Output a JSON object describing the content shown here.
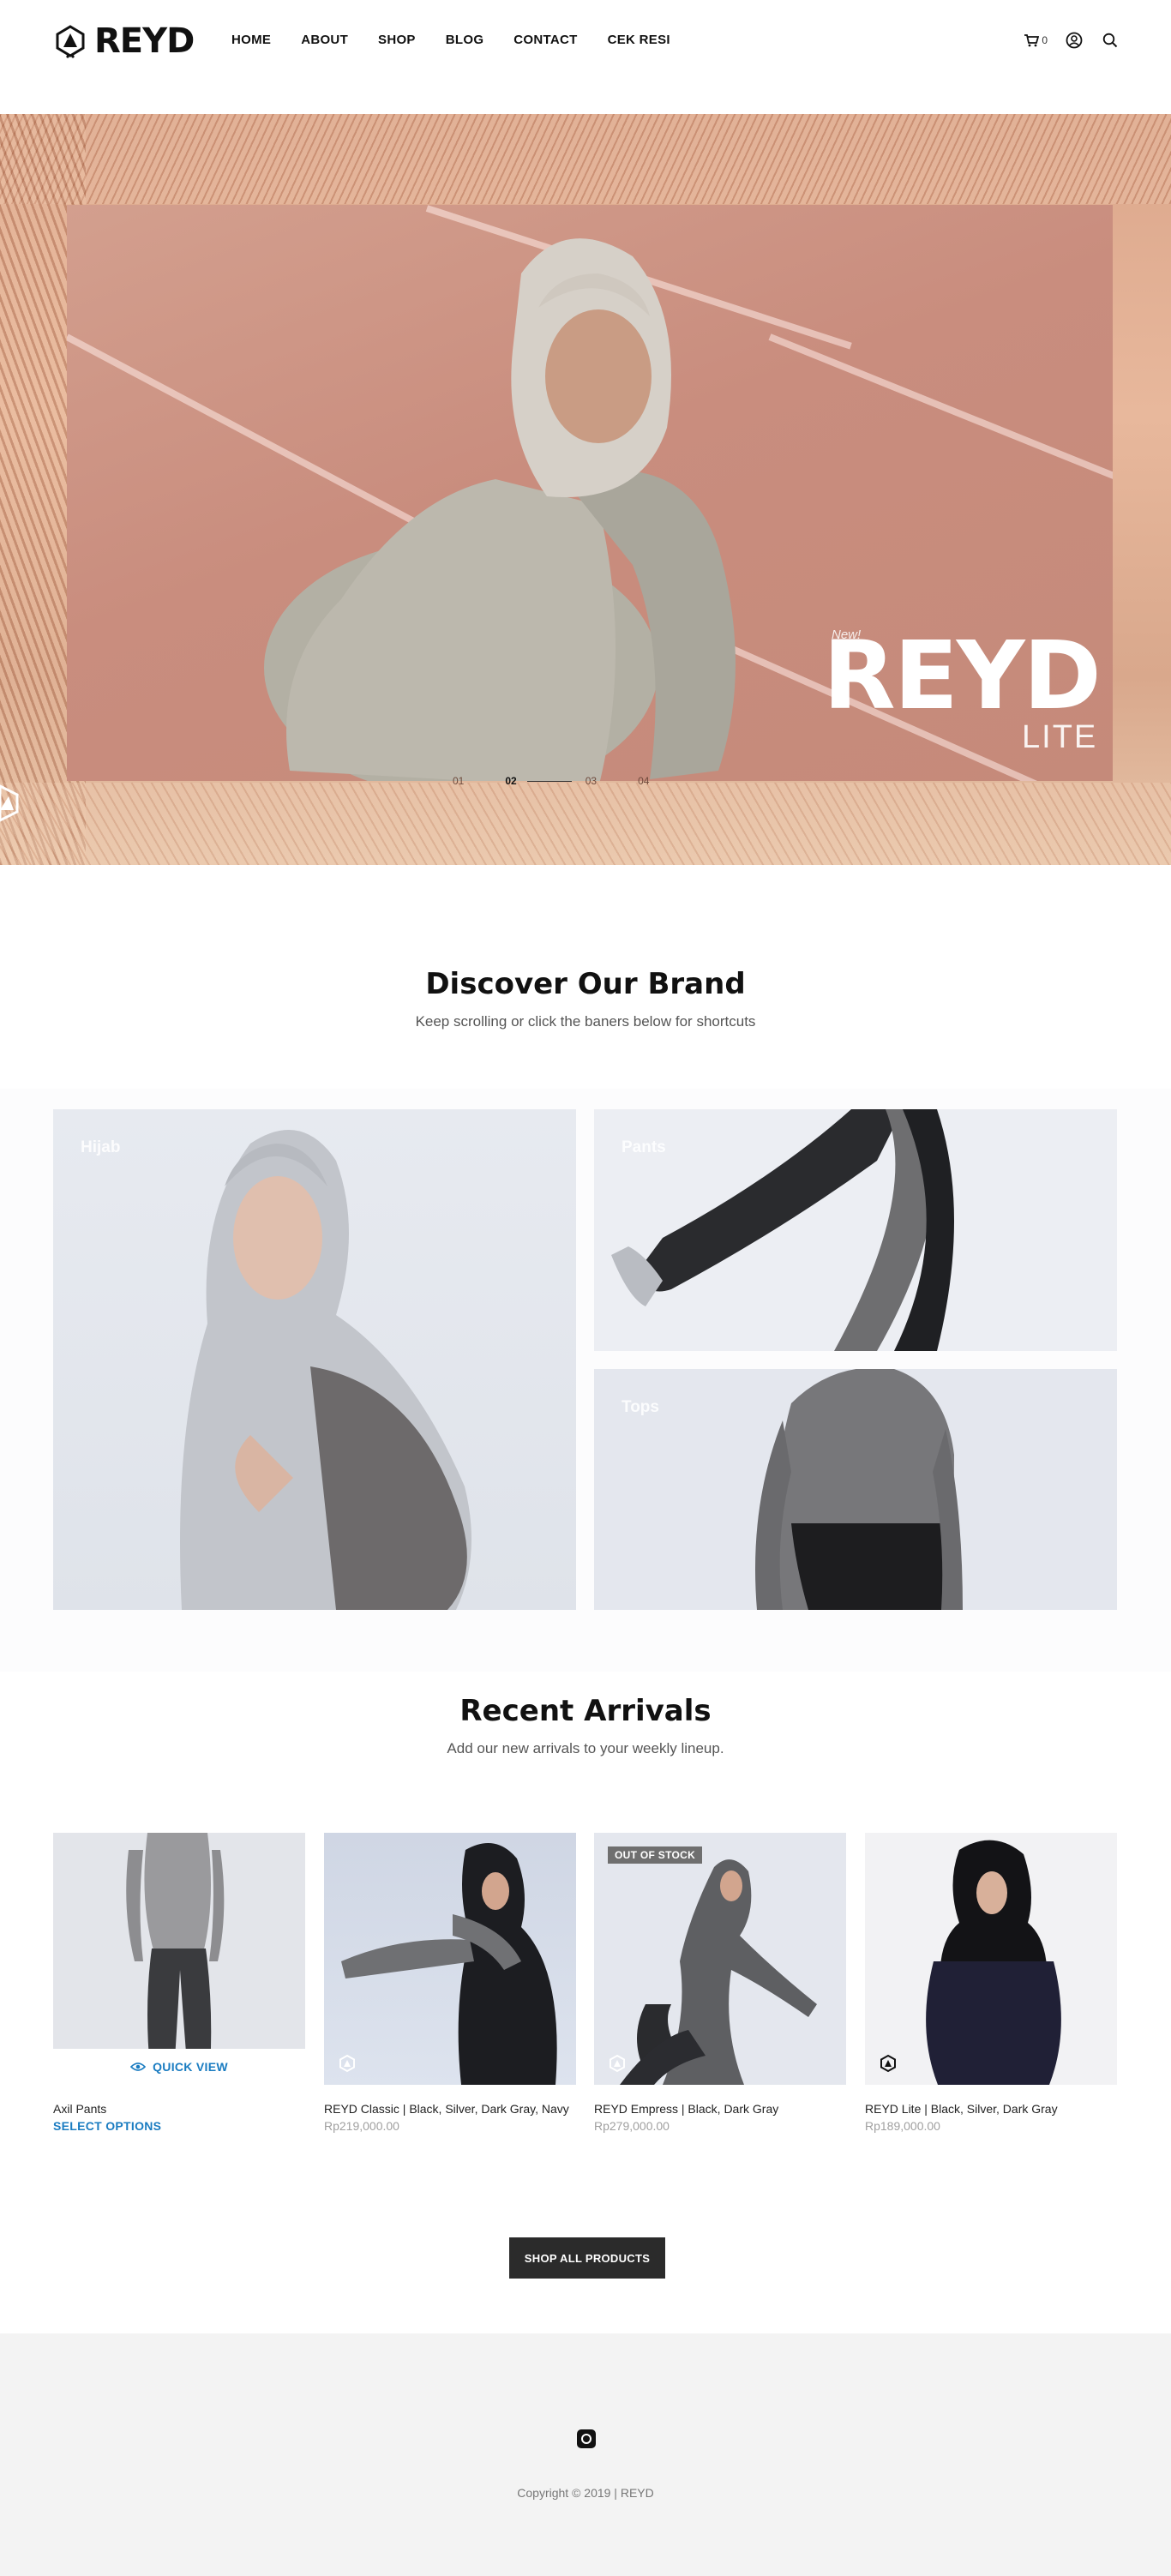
{
  "header": {
    "logo_text": "REYD",
    "nav": [
      "HOME",
      "ABOUT",
      "SHOP",
      "BLOG",
      "CONTACT",
      "CEK RESI"
    ],
    "cart_count": "0",
    "icons": [
      "cart-icon",
      "account-icon",
      "search-icon"
    ]
  },
  "hero": {
    "new_label": "New!",
    "brand": "REYD",
    "line": "LITE",
    "slides": [
      "01",
      "02",
      "03",
      "04"
    ],
    "active_slide": "02"
  },
  "discover": {
    "title": "Discover Our Brand",
    "subtitle": "Keep scrolling or click the baners below for shortcuts",
    "tiles": [
      "Hijab",
      "Pants",
      "Tops"
    ]
  },
  "arrivals": {
    "title": "Recent Arrivals",
    "subtitle": "Add our new arrivals to your weekly lineup.",
    "products": [
      {
        "name": "Axil Pants",
        "price": "",
        "action": "SELECT OPTIONS",
        "quickview": "QUICK VIEW",
        "badge": ""
      },
      {
        "name": "REYD Classic | Black, Silver, Dark Gray, Navy",
        "price": "Rp219,000.00",
        "action": "",
        "quickview": "",
        "badge": ""
      },
      {
        "name": "REYD Empress | Black, Dark Gray",
        "price": "Rp279,000.00",
        "action": "",
        "quickview": "",
        "badge": "OUT OF STOCK"
      },
      {
        "name": "REYD Lite | Black, Silver, Dark Gray",
        "price": "Rp189,000.00",
        "action": "",
        "quickview": "",
        "badge": ""
      }
    ],
    "shop_all": "SHOP ALL PRODUCTS"
  },
  "footer": {
    "copyright": "Copyright © 2019 | REYD",
    "social": "instagram-icon"
  },
  "colors": {
    "accent": "#1a7cc1",
    "hero_bg": "#dba68b",
    "button_bg": "#2b2b2b",
    "footer_bg": "#f3f3f3"
  }
}
